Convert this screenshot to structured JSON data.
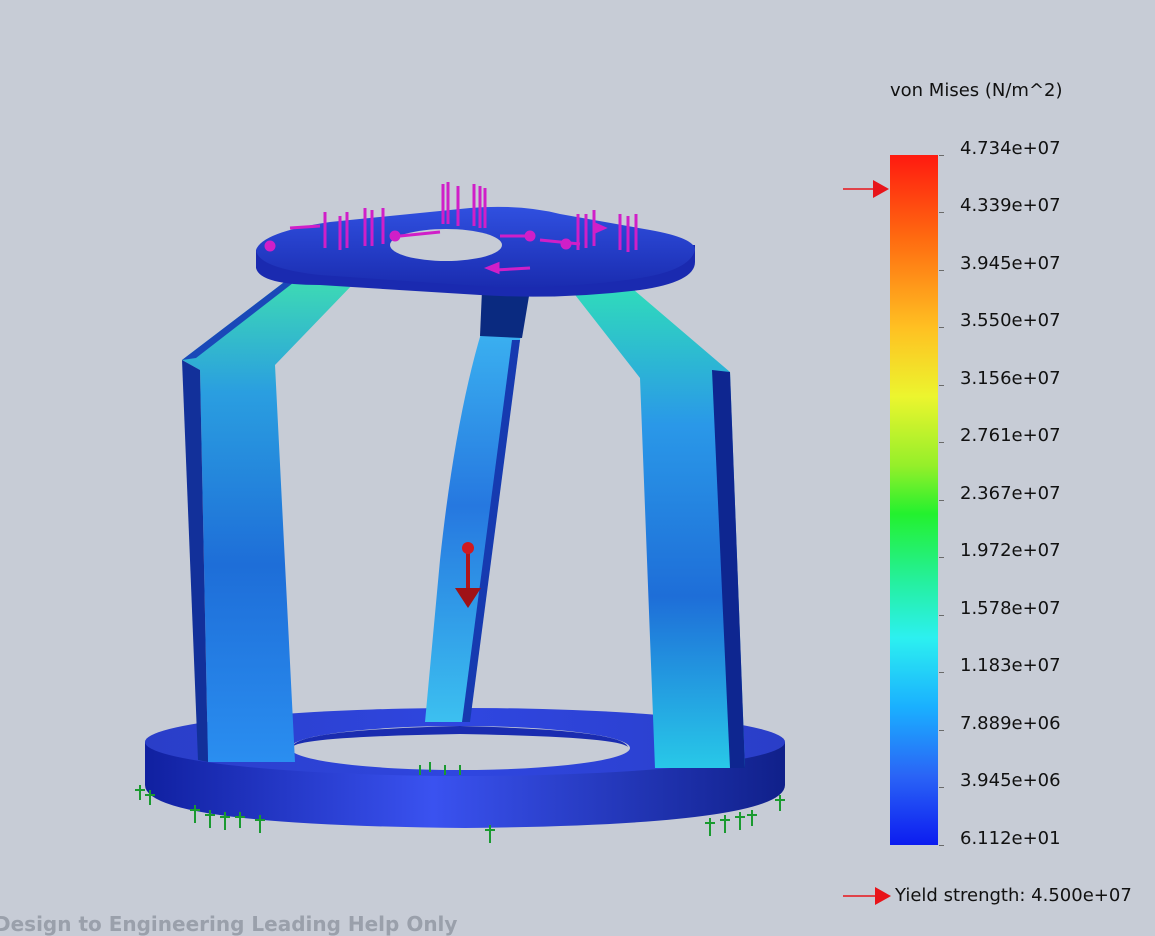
{
  "legend": {
    "title": "von Mises (N/m^2)",
    "ticks": [
      "4.734e+07",
      "4.339e+07",
      "3.945e+07",
      "3.550e+07",
      "3.156e+07",
      "2.761e+07",
      "2.367e+07",
      "1.972e+07",
      "1.578e+07",
      "1.183e+07",
      "7.889e+06",
      "3.945e+06",
      "6.112e+01"
    ],
    "yield_text": "Yield strength: 4.500e+07",
    "colors": {
      "max": "#ff1a10",
      "min": "#0c1cf0",
      "yield_arrow": "#e8141a"
    }
  },
  "model": {
    "load_color": "#d01fc8",
    "fixture_color": "#1a9a30",
    "force_arrow_color": "#b0151a"
  },
  "footer": {
    "text": "Design to Engineering Leading Help Only"
  }
}
